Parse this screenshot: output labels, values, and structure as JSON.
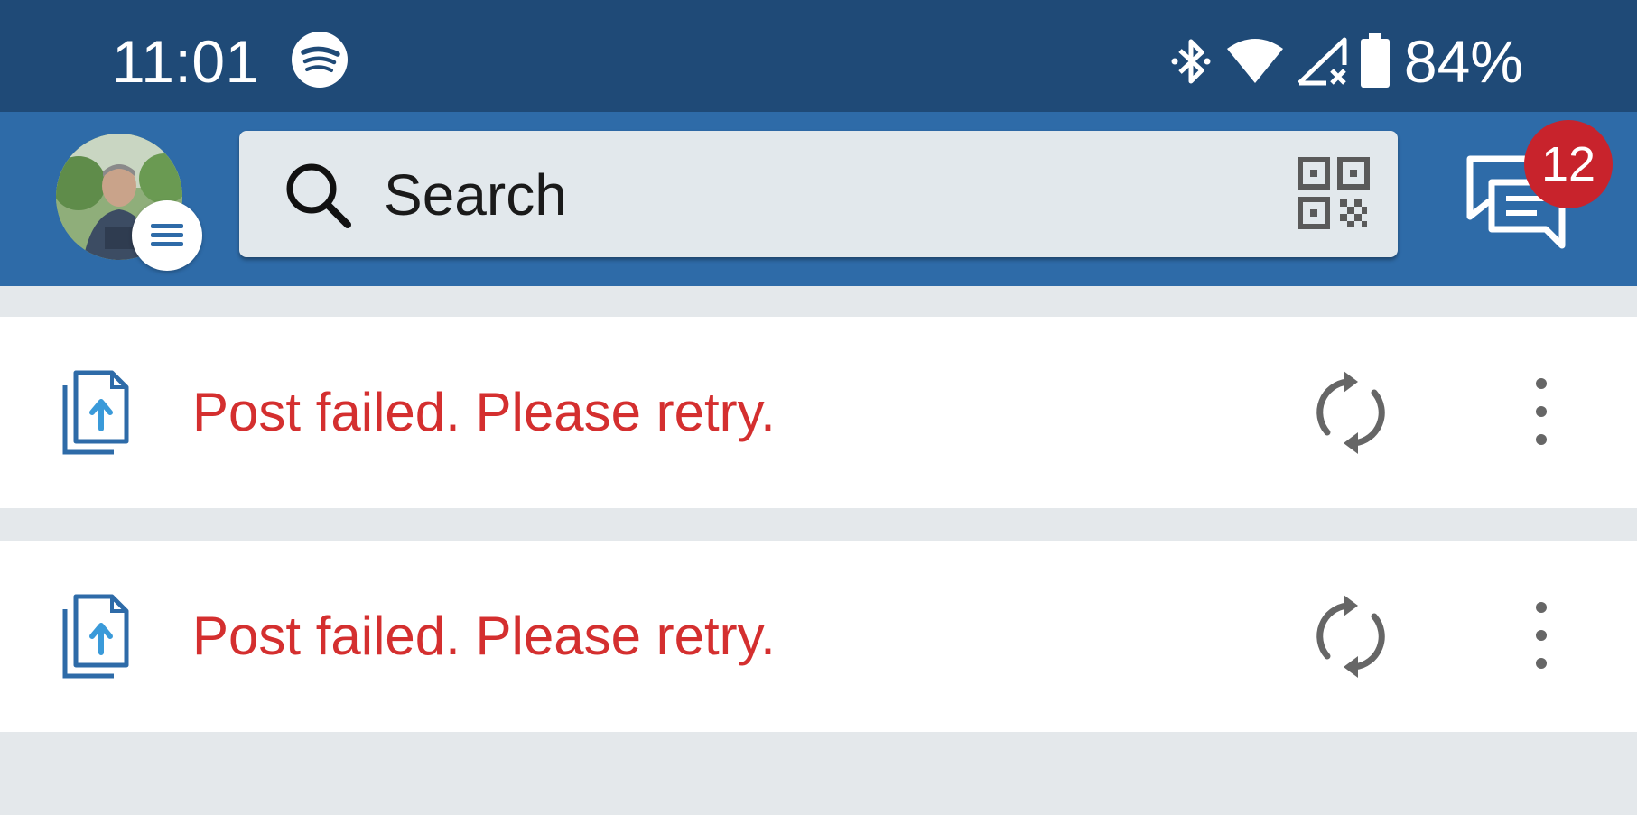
{
  "status_bar": {
    "time": "11:01",
    "battery_percent": "84%",
    "icons": [
      "spotify-icon",
      "bluetooth-icon",
      "wifi-icon",
      "cell-signal-icon",
      "battery-icon"
    ]
  },
  "header": {
    "search_placeholder": "Search",
    "messages_count": "12",
    "icons": [
      "avatar",
      "menu-icon",
      "search-icon",
      "qr-code-icon",
      "messages-icon"
    ]
  },
  "feed": {
    "items": [
      {
        "message": "Post failed. Please retry.",
        "icons": [
          "upload-file-icon",
          "retry-icon",
          "more-options-icon"
        ]
      },
      {
        "message": "Post failed. Please retry.",
        "icons": [
          "upload-file-icon",
          "retry-icon",
          "more-options-icon"
        ]
      }
    ]
  },
  "colors": {
    "status_bar_bg": "#1f4a77",
    "header_bg": "#2e6ba8",
    "search_bg": "#e2e8ec",
    "error_text": "#d42f2f",
    "badge_red": "#c8232c",
    "feed_bg": "#e4e8eb",
    "icon_blue": "#2e6ba8",
    "icon_grey": "#666666"
  }
}
